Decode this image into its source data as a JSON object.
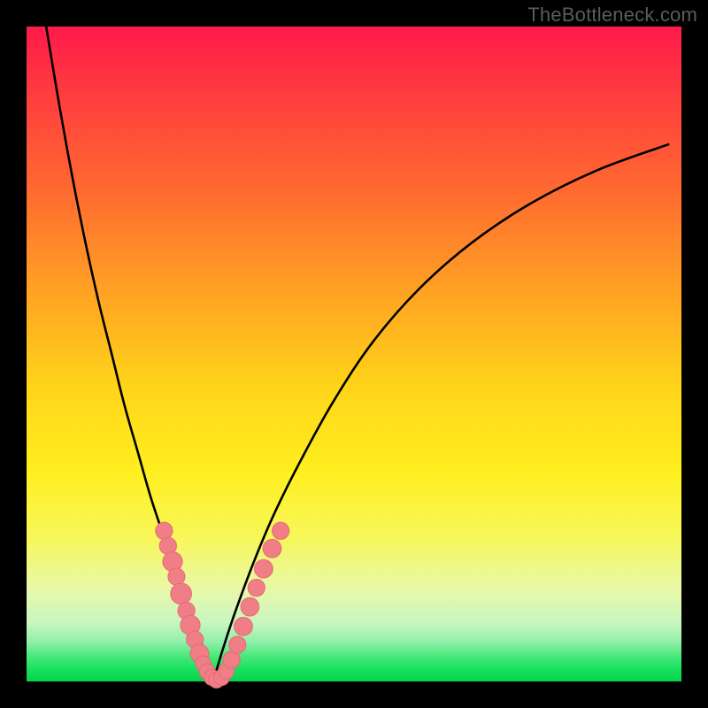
{
  "watermark": "TheBottleneck.com",
  "colors": {
    "background": "#000000",
    "curve_stroke": "#000000",
    "marker_fill": "#ef7e87",
    "marker_stroke": "#e86a74"
  },
  "chart_data": {
    "type": "line",
    "title": "",
    "xlabel": "",
    "ylabel": "",
    "xlim": [
      0,
      100
    ],
    "ylim": [
      0,
      100
    ],
    "grid": false,
    "legend": false,
    "series": [
      {
        "name": "left-curve",
        "x": [
          3,
          5,
          7,
          9,
          11,
          13,
          15,
          17,
          19,
          21,
          23,
          25,
          27,
          28.5
        ],
        "y": [
          100,
          88,
          77,
          67,
          58,
          50,
          42,
          35,
          28,
          22,
          16,
          10,
          5,
          0
        ]
      },
      {
        "name": "right-curve",
        "x": [
          28.5,
          30,
          32,
          35,
          38,
          42,
          47,
          53,
          60,
          68,
          77,
          87,
          98
        ],
        "y": [
          0,
          5,
          11,
          19,
          26,
          34,
          43,
          52,
          60,
          67,
          73,
          78,
          82
        ]
      }
    ],
    "markers": [
      {
        "x": 21.0,
        "y": 23.0,
        "r": 1.3
      },
      {
        "x": 21.6,
        "y": 20.7,
        "r": 1.3
      },
      {
        "x": 22.3,
        "y": 18.3,
        "r": 1.5
      },
      {
        "x": 22.9,
        "y": 16.0,
        "r": 1.3
      },
      {
        "x": 23.6,
        "y": 13.4,
        "r": 1.6
      },
      {
        "x": 24.4,
        "y": 10.8,
        "r": 1.3
      },
      {
        "x": 25.0,
        "y": 8.6,
        "r": 1.5
      },
      {
        "x": 25.7,
        "y": 6.4,
        "r": 1.3
      },
      {
        "x": 26.4,
        "y": 4.3,
        "r": 1.4
      },
      {
        "x": 27.0,
        "y": 2.7,
        "r": 1.2
      },
      {
        "x": 27.6,
        "y": 1.5,
        "r": 1.2
      },
      {
        "x": 28.3,
        "y": 0.6,
        "r": 1.2
      },
      {
        "x": 29.0,
        "y": 0.2,
        "r": 1.2
      },
      {
        "x": 29.8,
        "y": 0.6,
        "r": 1.2
      },
      {
        "x": 30.5,
        "y": 1.6,
        "r": 1.2
      },
      {
        "x": 31.3,
        "y": 3.3,
        "r": 1.3
      },
      {
        "x": 32.2,
        "y": 5.6,
        "r": 1.3
      },
      {
        "x": 33.1,
        "y": 8.4,
        "r": 1.4
      },
      {
        "x": 34.1,
        "y": 11.4,
        "r": 1.4
      },
      {
        "x": 35.1,
        "y": 14.3,
        "r": 1.3
      },
      {
        "x": 36.2,
        "y": 17.2,
        "r": 1.4
      },
      {
        "x": 37.5,
        "y": 20.3,
        "r": 1.4
      },
      {
        "x": 38.8,
        "y": 23.0,
        "r": 1.3
      }
    ]
  }
}
